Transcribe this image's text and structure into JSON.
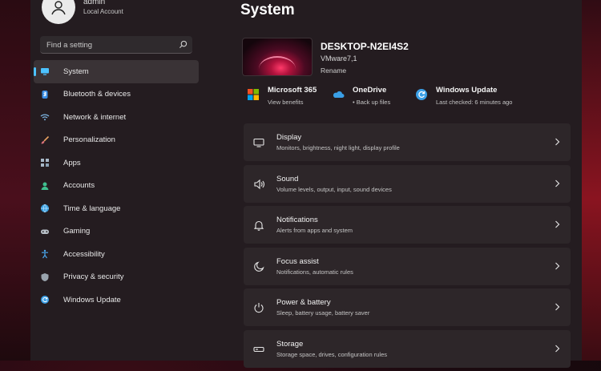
{
  "user": {
    "name": "admin",
    "account_type": "Local Account"
  },
  "search": {
    "placeholder": "Find a setting"
  },
  "sidebar": {
    "items": [
      {
        "label": "System",
        "icon": "monitor-icon"
      },
      {
        "label": "Bluetooth & devices",
        "icon": "bluetooth-icon"
      },
      {
        "label": "Network & internet",
        "icon": "wifi-icon"
      },
      {
        "label": "Personalization",
        "icon": "brush-icon"
      },
      {
        "label": "Apps",
        "icon": "apps-icon"
      },
      {
        "label": "Accounts",
        "icon": "person-icon"
      },
      {
        "label": "Time & language",
        "icon": "globe-clock-icon"
      },
      {
        "label": "Gaming",
        "icon": "gamepad-icon"
      },
      {
        "label": "Accessibility",
        "icon": "accessibility-icon"
      },
      {
        "label": "Privacy & security",
        "icon": "shield-icon"
      },
      {
        "label": "Windows Update",
        "icon": "update-icon"
      }
    ],
    "active_index": 0
  },
  "main": {
    "title": "System",
    "device": {
      "name": "DESKTOP-N2EI4S2",
      "model": "VMware7,1",
      "rename_label": "Rename"
    },
    "quick": [
      {
        "title": "Microsoft 365",
        "subtitle": "View benefits",
        "icon": "microsoft-365-icon"
      },
      {
        "title": "OneDrive",
        "subtitle": "• Back up files",
        "icon": "onedrive-icon"
      },
      {
        "title": "Windows Update",
        "subtitle": "Last checked: 6 minutes ago",
        "icon": "windows-update-icon"
      }
    ],
    "cards": [
      {
        "title": "Display",
        "subtitle": "Monitors, brightness, night light, display profile",
        "icon": "display-icon"
      },
      {
        "title": "Sound",
        "subtitle": "Volume levels, output, input, sound devices",
        "icon": "speaker-icon"
      },
      {
        "title": "Notifications",
        "subtitle": "Alerts from apps and system",
        "icon": "bell-icon"
      },
      {
        "title": "Focus assist",
        "subtitle": "Notifications, automatic rules",
        "icon": "moon-icon"
      },
      {
        "title": "Power & battery",
        "subtitle": "Sleep, battery usage, battery saver",
        "icon": "power-icon"
      },
      {
        "title": "Storage",
        "subtitle": "Storage space, drives, configuration rules",
        "icon": "storage-icon"
      }
    ]
  },
  "colors": {
    "accent": "#4cc2ff",
    "window_bg": "#241c20",
    "card_bg": "#2d2629"
  }
}
